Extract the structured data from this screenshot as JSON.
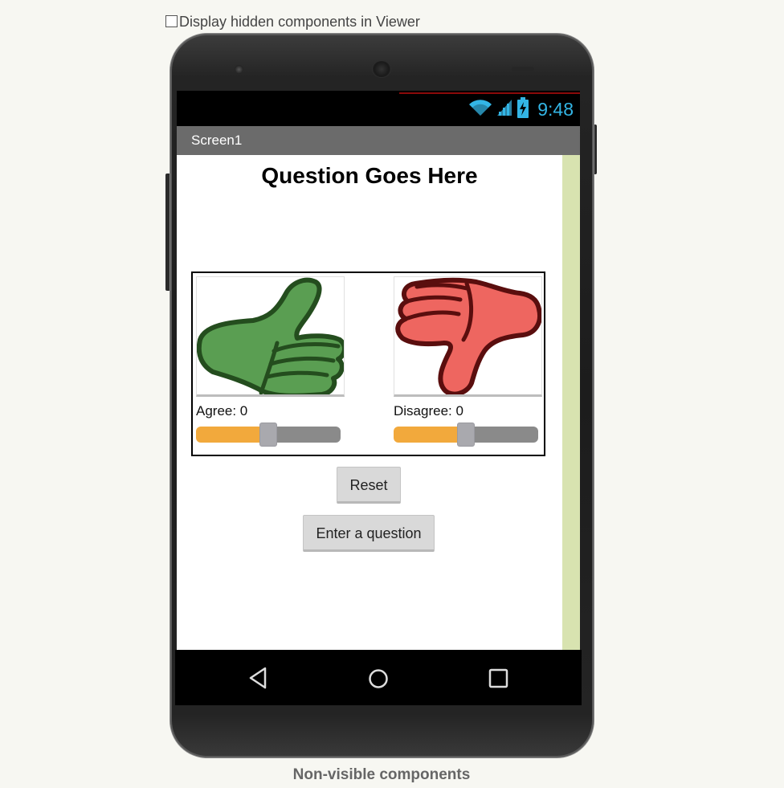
{
  "viewer": {
    "hidden_components_label": "Display hidden components in Viewer",
    "hidden_components_checked": false,
    "non_visible_label": "Non-visible components"
  },
  "statusbar": {
    "time": "9:48",
    "accent_color": "#33b5e5"
  },
  "screen": {
    "title": "Screen1",
    "question": "Question Goes Here",
    "agree": {
      "label": "Agree: 0",
      "slider_value_fraction": 0.5,
      "image_icon": "thumbs-up-icon",
      "color": "#5a9e52"
    },
    "disagree": {
      "label": "Disagree: 0",
      "slider_value_fraction": 0.5,
      "image_icon": "thumbs-down-icon",
      "color": "#ee6660"
    },
    "buttons": {
      "reset": "Reset",
      "enter_question": "Enter a question"
    }
  },
  "navbar": {
    "icons": [
      "back-icon",
      "home-icon",
      "recents-icon"
    ]
  },
  "colors": {
    "slider_filled": "#f2a93c",
    "slider_empty": "#8a8a8a",
    "side_strip": "#d8e3b0",
    "action_bar": "#6b6b6b"
  }
}
